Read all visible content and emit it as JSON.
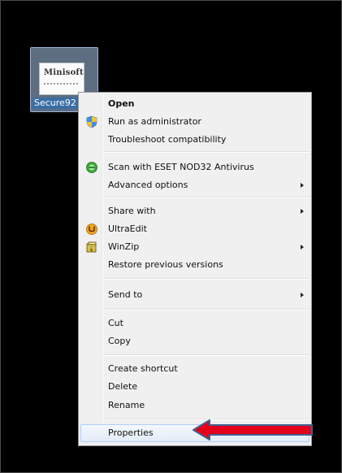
{
  "desktop": {
    "file_label": "Secure92",
    "thumbnail_text": "Minisoft"
  },
  "menu": {
    "items": [
      {
        "label": "Open",
        "bold": true
      },
      {
        "label": "Run as administrator",
        "icon": "uac-shield-icon"
      },
      {
        "label": "Troubleshoot compatibility"
      },
      {
        "label": "Scan with ESET NOD32 Antivirus",
        "icon": "eset-icon"
      },
      {
        "label": "Advanced options",
        "submenu": true
      },
      {
        "label": "Share with",
        "submenu": true
      },
      {
        "label": "UltraEdit",
        "icon": "ultraedit-icon"
      },
      {
        "label": "WinZip",
        "icon": "winzip-icon",
        "submenu": true
      },
      {
        "label": "Restore previous versions"
      },
      {
        "label": "Send to",
        "submenu": true
      },
      {
        "label": "Cut"
      },
      {
        "label": "Copy"
      },
      {
        "label": "Create shortcut"
      },
      {
        "label": "Delete"
      },
      {
        "label": "Rename"
      },
      {
        "label": "Properties",
        "highlighted": true
      }
    ]
  },
  "colors": {
    "annotation_arrow": "#e3001b",
    "annotation_outline": "#3f5f8f",
    "highlight_border": "#aecff7"
  }
}
